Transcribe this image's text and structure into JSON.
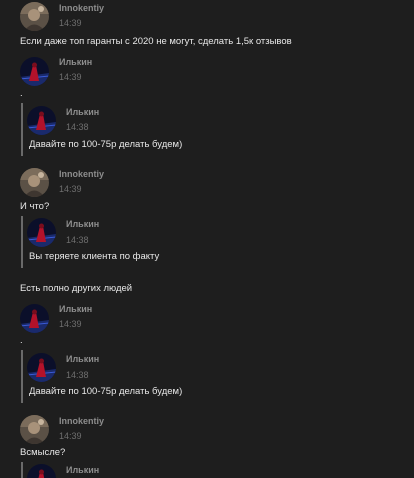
{
  "users": {
    "innokentiy": "Innokentiy",
    "ilkin": "Илькин"
  },
  "messages": [
    {
      "author": "Innokentiy",
      "time": "14:39",
      "text": "Если даже топ гаранты с 2020 не могут, сделать 1,5к отзывов"
    },
    {
      "author": "Илькин",
      "time": "14:39",
      "text": ".",
      "quote": {
        "author": "Илькин",
        "time": "14:38",
        "text": "Давайте по 100-75р делать будем)"
      }
    },
    {
      "author": "Innokentiy",
      "time": "14:39",
      "text": "И что?",
      "quote": {
        "author": "Илькин",
        "time": "14:38",
        "text": "Вы теряете клиента по факту"
      },
      "after": "Есть полно других людей"
    },
    {
      "author": "Илькин",
      "time": "14:39",
      "text": ".",
      "quote": {
        "author": "Илькин",
        "time": "14:38",
        "text": "Давайте по 100-75р делать будем)"
      }
    },
    {
      "author": "Innokentiy",
      "time": "14:39",
      "text": "Всмысле?",
      "quote": {
        "author": "Илькин",
        "time": "",
        "text": ""
      }
    }
  ],
  "colors": {
    "background": "#1e1e1e",
    "name": "#8d8d8d",
    "time": "#6e6e6e",
    "text": "#e8e8e8",
    "quote_bar": "#6a6a6a"
  }
}
